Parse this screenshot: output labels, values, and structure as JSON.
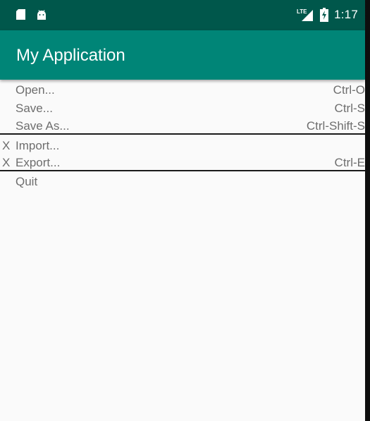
{
  "status_bar": {
    "icons": [
      "sd-card-icon",
      "android-icon",
      "lte-signal-icon",
      "battery-charging-icon"
    ],
    "network_label": "LTE",
    "time": "1:17"
  },
  "app_bar": {
    "title": "My Application",
    "color": "#008577",
    "status_color": "#00574b"
  },
  "menu": {
    "items": [
      {
        "label": "Open...",
        "shortcut": "Ctrl-O",
        "marker": ""
      },
      {
        "label": "Save...",
        "shortcut": "Ctrl-S",
        "marker": ""
      },
      {
        "label": "Save As...",
        "shortcut": "Ctrl-Shift-S",
        "marker": ""
      },
      {
        "label": "Import...",
        "shortcut": "",
        "marker": "X"
      },
      {
        "label": "Export...",
        "shortcut": "Ctrl-E",
        "marker": "X"
      },
      {
        "label": "Quit",
        "shortcut": "",
        "marker": ""
      }
    ]
  }
}
